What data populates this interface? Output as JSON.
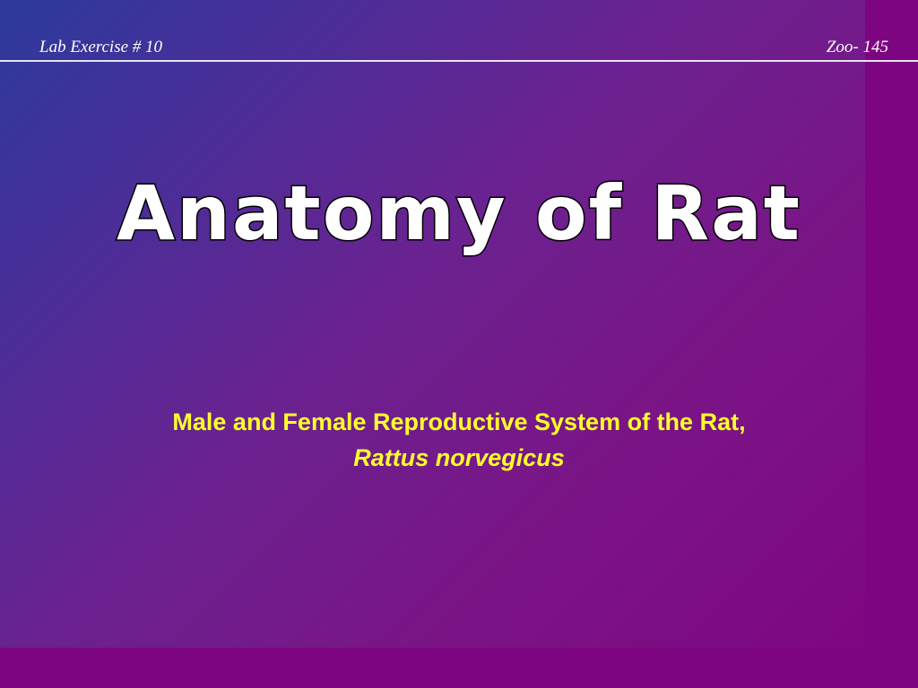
{
  "header": {
    "left_text": "Lab Exercise # 10",
    "right_text": "Zoo- 145"
  },
  "title": "Anatomy of Rat",
  "subtitle": {
    "line1": "Male and Female Reproductive System of the Rat,",
    "line2": "Rattus norvegicus"
  },
  "colors": {
    "background": "#7e0582",
    "gradient_start": "#2c3a9c",
    "title_fill": "#ffffff",
    "title_outline": "#000000",
    "subtitle": "#ffff2a"
  }
}
